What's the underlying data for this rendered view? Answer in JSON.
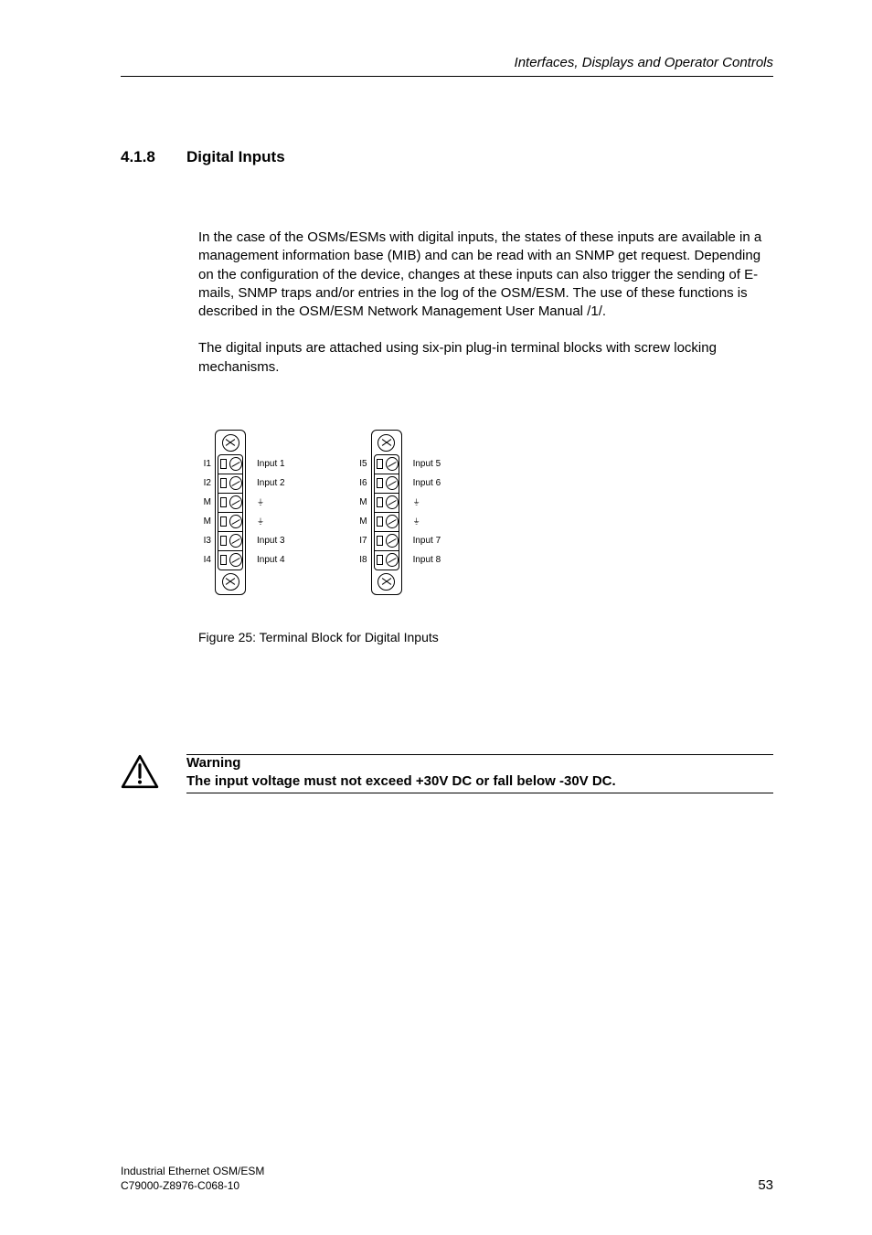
{
  "header": {
    "running_title": "Interfaces, Displays and Operator Controls"
  },
  "section": {
    "number": "4.1.8",
    "title": "Digital Inputs"
  },
  "body": {
    "para1": "In the case of the OSMs/ESMs with digital inputs, the states of these inputs are available in a management information base (MIB) and can be read with an SNMP get request. Depending on the configuration of the device, changes at these inputs can also trigger the sending of E-mails, SNMP traps and/or entries in the log of the OSM/ESM. The use of these functions is described in the OSM/ESM Network Management User Manual /1/.",
    "para2": "The digital inputs are attached using six-pin plug-in terminal blocks with screw locking mechanisms."
  },
  "figure": {
    "caption": "Figure 25: Terminal Block for Digital Inputs",
    "blocks": [
      {
        "pins": [
          "I1",
          "I2",
          "M",
          "M",
          "I3",
          "I4"
        ],
        "desc": [
          "Input 1",
          "Input 2",
          "⏚",
          "⏚",
          "Input 3",
          "Input 4"
        ]
      },
      {
        "pins": [
          "I5",
          "I6",
          "M",
          "M",
          "I7",
          "I8"
        ],
        "desc": [
          "Input 5",
          "Input 6",
          "⏚",
          "⏚",
          "Input 7",
          "Input 8"
        ]
      }
    ]
  },
  "warning": {
    "label": "Warning",
    "text": "The input voltage must not exceed +30V DC or fall below -30V DC."
  },
  "footer": {
    "line1": "Industrial Ethernet OSM/ESM",
    "line2": "C79000-Z8976-C068-10",
    "page": "53"
  }
}
